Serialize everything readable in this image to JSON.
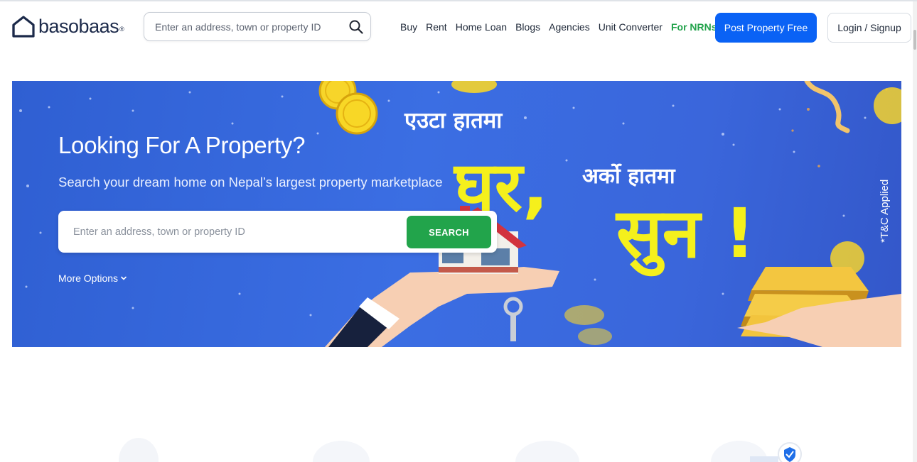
{
  "header": {
    "logo_text": "basobaas",
    "logo_mark": "®",
    "search_placeholder": "Enter an address, town or property ID",
    "nav": {
      "buy": "Buy",
      "rent": "Rent",
      "home_loan": "Home Loan",
      "blogs": "Blogs",
      "agencies": "Agencies",
      "unit_converter": "Unit Converter",
      "for_nrns": "For NRNs"
    },
    "post_property": "Post Property Free",
    "login": "Login / Signup"
  },
  "hero": {
    "title": "Looking For A Property?",
    "subtitle": "Search your dream home on Nepal’s largest property marketplace",
    "search_placeholder": "Enter an address, town or property ID",
    "search_button": "SEARCH",
    "more_options": "More Options",
    "banner": {
      "line1": "एउटा हातमा",
      "word1": "घर,",
      "line2": "अर्को हातमा",
      "word2": "सुन !",
      "tc": "*T&C Applied"
    }
  },
  "colors": {
    "brand_blue": "#0a62f5",
    "green": "#22a44b",
    "hero_blue": "#3b6ee3",
    "yellow": "#f5f01c"
  },
  "icons": {
    "search": "search-icon",
    "chevron": "chevron-down-icon",
    "logo": "house-logo-icon",
    "badge": "shield-check-icon"
  }
}
